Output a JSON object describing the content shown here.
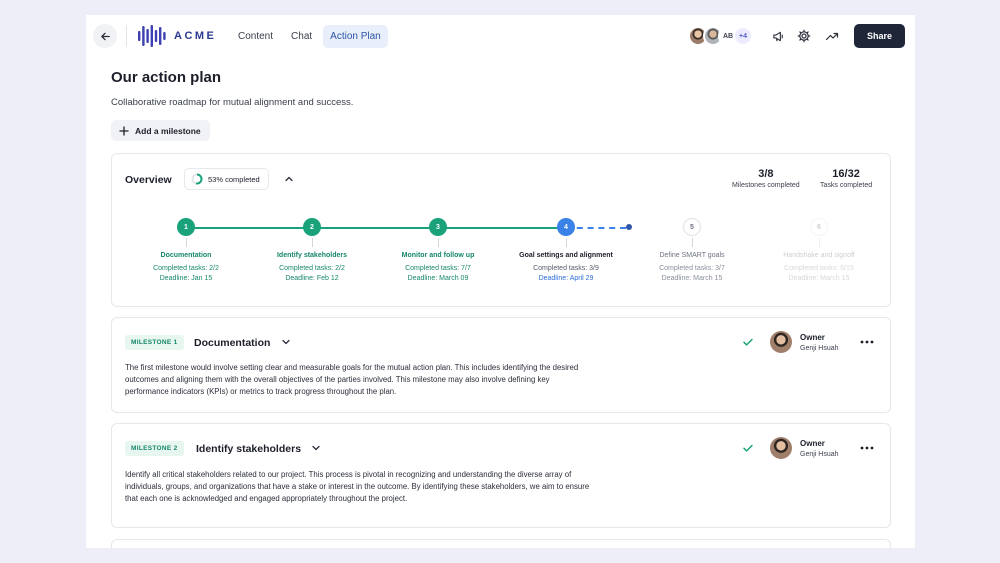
{
  "logo": {
    "text": "ACME"
  },
  "nav": {
    "items": [
      "Content",
      "Chat",
      "Action Plan"
    ],
    "active": 2
  },
  "collaborators": {
    "initials": "AB",
    "more": "+4"
  },
  "toolbar": {
    "share_label": "Share"
  },
  "icons": {
    "back": "arrow-left-icon",
    "announce": "megaphone-icon",
    "settings": "gear-icon",
    "trend": "trend-up-icon"
  },
  "page": {
    "title": "Our action plan",
    "subtitle": "Collaborative roadmap for mutual alignment and success.",
    "add_milestone_label": "Add a milestone"
  },
  "overview": {
    "title": "Overview",
    "progress_label": "53% completed",
    "progress_fraction": 0.53,
    "milestones_value": "3/8",
    "milestones_label": "Milestones completed",
    "tasks_value": "16/32",
    "tasks_label": "Tasks completed",
    "steps": [
      {
        "num": "1",
        "name": "Documentation",
        "tasks": "Completed tasks: 2/2",
        "deadline": "Deadline: Jan 15",
        "state": "done"
      },
      {
        "num": "2",
        "name": "Identify stakeholders",
        "tasks": "Completed tasks: 2/2",
        "deadline": "Deadline: Feb 12",
        "state": "done"
      },
      {
        "num": "3",
        "name": "Monitor and follow up",
        "tasks": "Completed tasks: 7/7",
        "deadline": "Deadline: March 09",
        "state": "done"
      },
      {
        "num": "4",
        "name": "Goal settings and alignment",
        "tasks": "Completed tasks: 3/9",
        "deadline": "Deadline: April 29",
        "state": "current"
      },
      {
        "num": "5",
        "name": "Define SMART goals",
        "tasks": "Completed tasks: 3/7",
        "deadline": "Deadline: March 15",
        "state": "future"
      },
      {
        "num": "6",
        "name": "Handshake and signoff",
        "tasks": "Completed tasks: 6/15",
        "deadline": "Deadline: March 15",
        "state": "faded"
      }
    ]
  },
  "milestones": [
    {
      "badge": "MILESTONE 1",
      "title": "Documentation",
      "owner_label": "Owner",
      "owner_name": "Genji Hsuah",
      "description": "The first milestone would involve setting clear and measurable goals for the mutual action plan. This includes identifying the desired outcomes and aligning them with the overall objectives of the parties involved. This milestone may also involve defining key performance indicators (KPIs) or metrics to track progress throughout the plan."
    },
    {
      "badge": "MILESTONE 2",
      "title": "Identify stakeholders",
      "owner_label": "Owner",
      "owner_name": "Genji Hsuah",
      "description": "Identify all critical stakeholders related to our project. This process is pivotal in recognizing and understanding the diverse array of individuals, groups, and organizations that have a stake or interest in the outcome. By identifying these stakeholders, we aim to ensure that each one is acknowledged and engaged appropriately throughout the project."
    }
  ],
  "colors": {
    "accent": "#2d55a8",
    "success": "#1aa37a",
    "current": "#3b82e8",
    "dark": "#1e2638"
  }
}
